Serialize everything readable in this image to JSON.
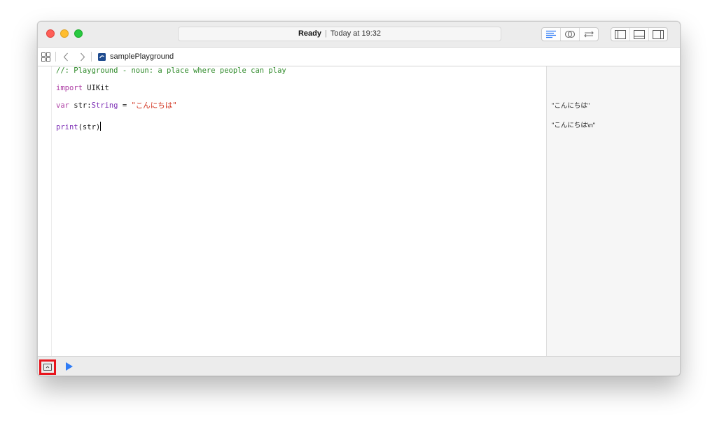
{
  "titlebar": {
    "status_state": "Ready",
    "status_separator": "|",
    "status_time": "Today at 19:32",
    "icons": [
      "standard-editor-icon",
      "assistant-editor-icon",
      "version-editor-icon",
      "navigator-toggle-icon",
      "debug-area-toggle-icon",
      "utilities-toggle-icon"
    ]
  },
  "jumpbar": {
    "file_name": "samplePlayground",
    "icons": [
      "related-items-icon",
      "back-chevron-icon",
      "forward-chevron-icon",
      "playground-file-icon"
    ]
  },
  "editor": {
    "line1": {
      "comment": "//: Playground - noun: a place where people can play"
    },
    "line2": {
      "keyword": "import",
      "module": " UIKit"
    },
    "line3": {
      "keyword": "var",
      "name": " str:",
      "type": "String",
      "equals": " = ",
      "string": "\"こんにちは\""
    },
    "line4": {
      "func": "print",
      "args": "(str)"
    }
  },
  "results": {
    "result1": "\"こんにちは\"",
    "result2": "\"こんにちは\\n\""
  },
  "bottombar": {
    "icons": [
      "show-debug-area-icon",
      "run-icon"
    ]
  },
  "colors": {
    "comment": "#2f8a2a",
    "keyword": "#ad3da4",
    "string": "#d12f1b",
    "highlight_box": "#e8141c",
    "run_button": "#2f7cf6"
  }
}
